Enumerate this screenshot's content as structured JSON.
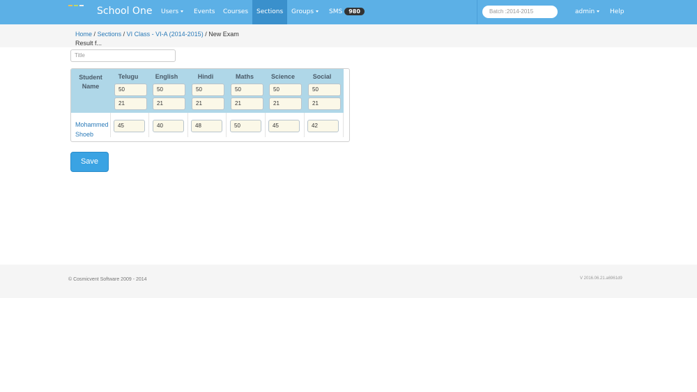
{
  "app": {
    "brand": "School One",
    "accent_color": "#5cb0e6"
  },
  "nav": {
    "users": "Users",
    "events": "Events",
    "courses": "Courses",
    "sections": "Sections",
    "groups": "Groups",
    "sms": "SMS",
    "sms_count": "980",
    "batch_placeholder": "Batch :2014-2015",
    "admin": "admin",
    "help": "Help"
  },
  "breadcrumb": {
    "home": "Home",
    "sep": "/",
    "sections": "Sections",
    "class": "VI Class - VI-A (2014-2015)",
    "current": "/ New Exam Result f..."
  },
  "form": {
    "title_placeholder": "Title"
  },
  "table": {
    "student_header": "Student Name",
    "subjects": [
      {
        "name": "Telugu",
        "max": "50",
        "min": "21",
        "mark": "45"
      },
      {
        "name": "English",
        "max": "50",
        "min": "21",
        "mark": "40"
      },
      {
        "name": "Hindi",
        "max": "50",
        "min": "21",
        "mark": "48"
      },
      {
        "name": "Maths",
        "max": "50",
        "min": "21",
        "mark": "50"
      },
      {
        "name": "Science",
        "max": "50",
        "min": "21",
        "mark": "45"
      },
      {
        "name": "Social",
        "max": "50",
        "min": "21",
        "mark": "42"
      }
    ],
    "student_name": "Mohammed Shoeb"
  },
  "actions": {
    "save": "Save"
  },
  "footer": {
    "copyright": "© Cosmicvent Software 2009 - 2014",
    "version": "V 2016.06.21.a6961d9"
  }
}
